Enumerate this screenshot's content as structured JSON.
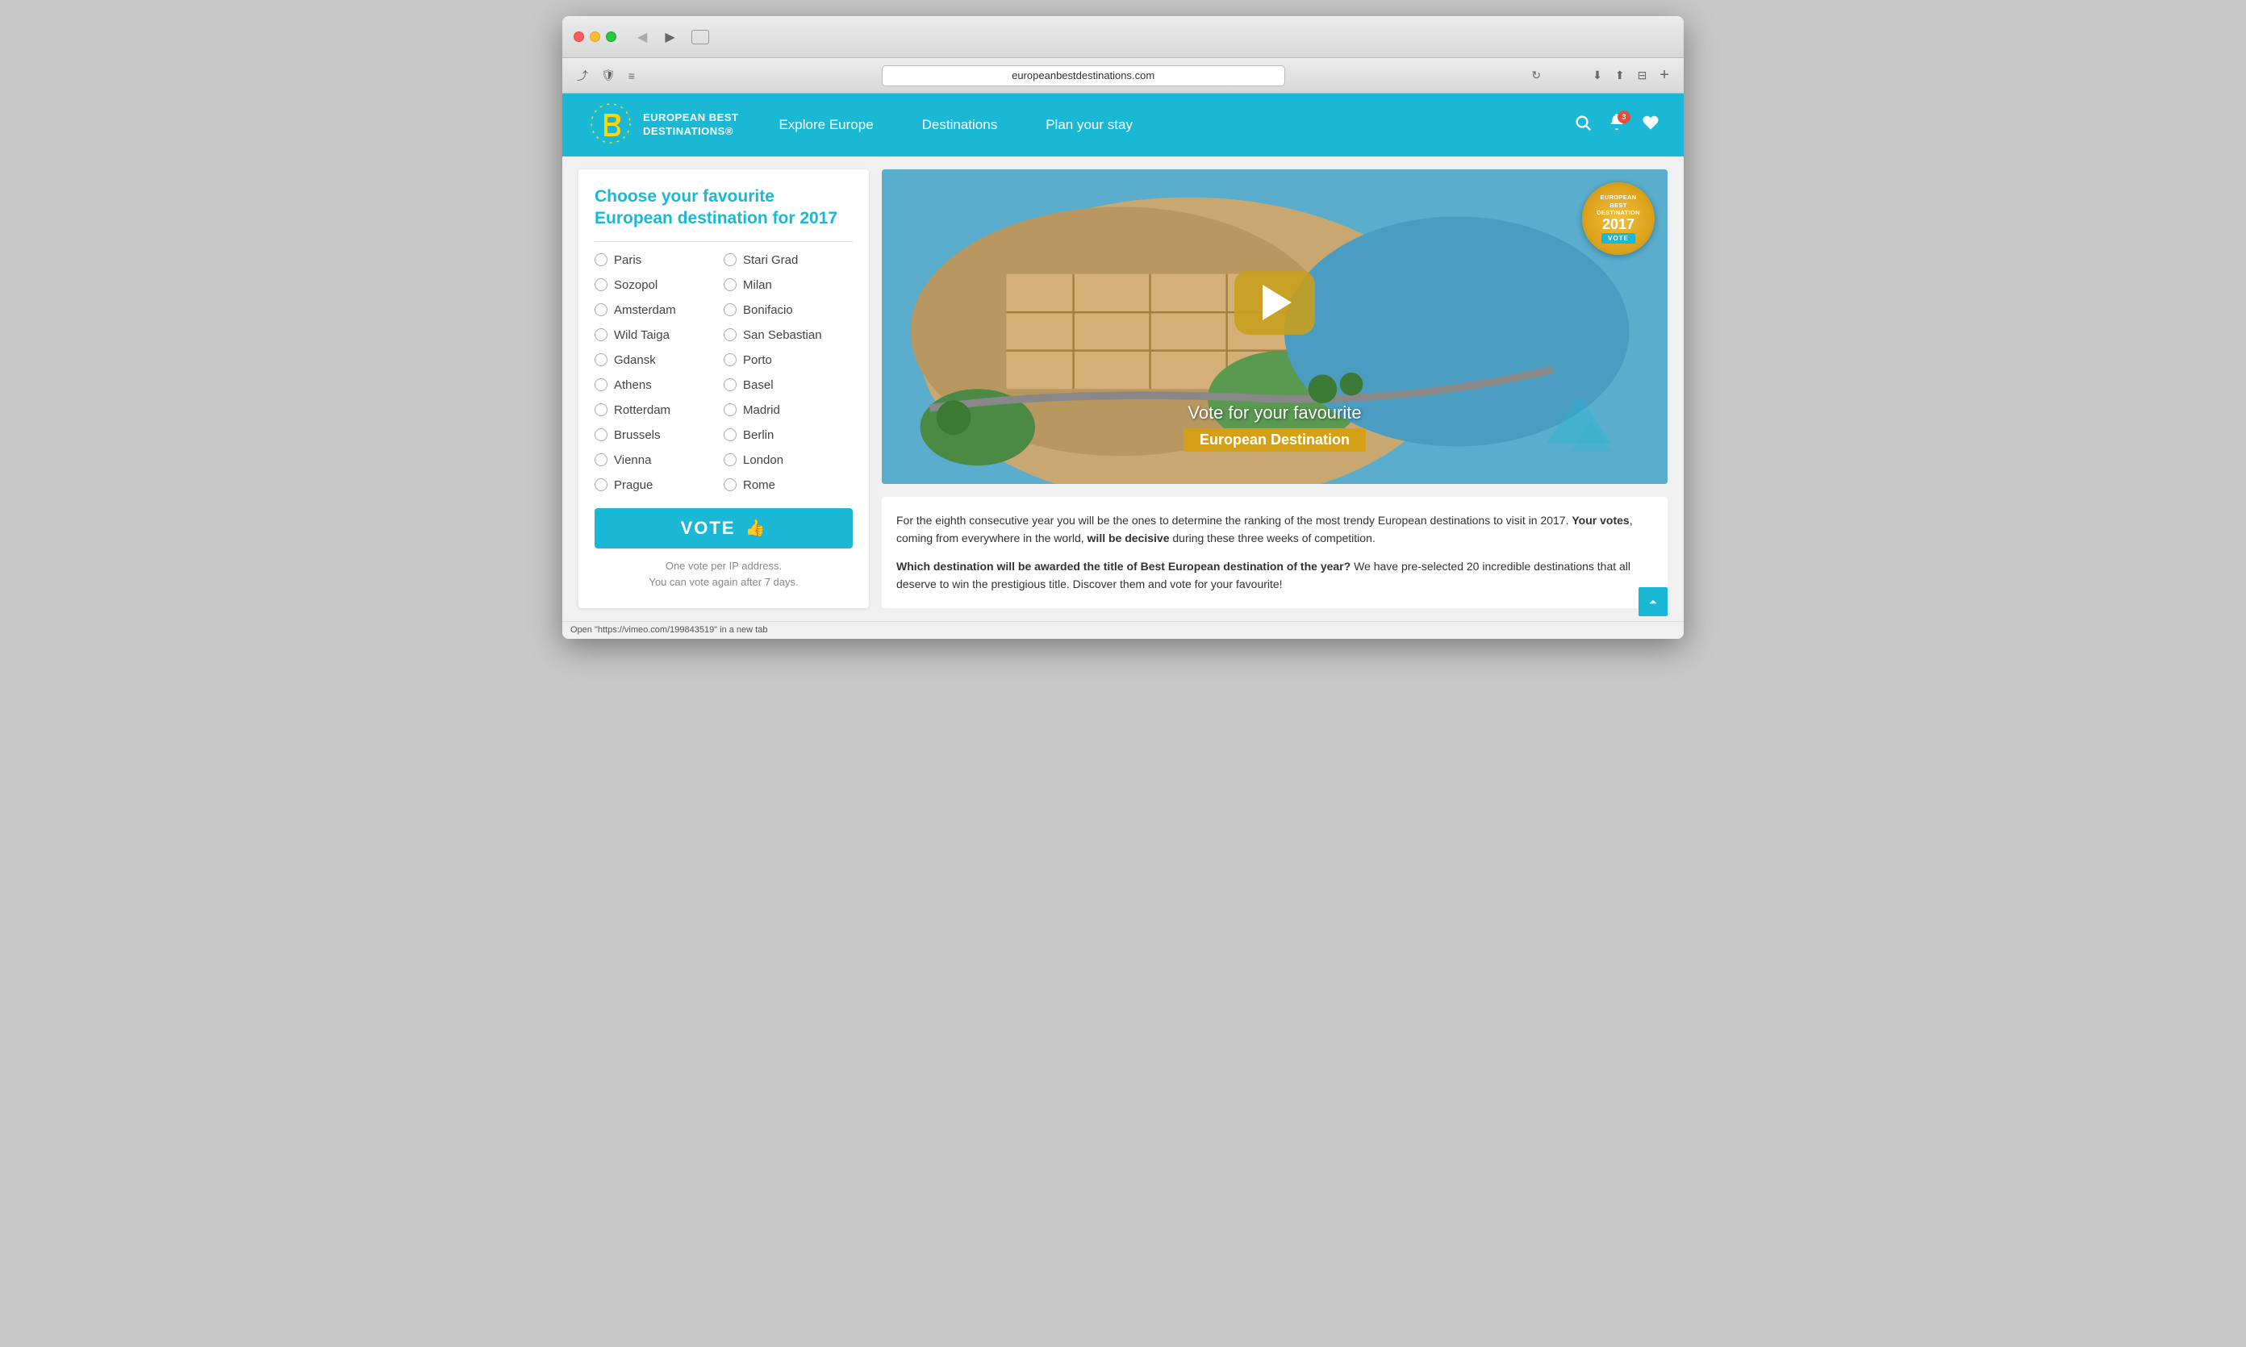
{
  "browser": {
    "url": "europeanbestdestinations.com",
    "back_btn": "‹",
    "forward_btn": "›"
  },
  "header": {
    "logo_line1": "European Best",
    "logo_line2": "Destinations®",
    "nav": {
      "items": [
        {
          "label": "Explore Europe",
          "id": "explore-europe"
        },
        {
          "label": "Destinations",
          "id": "destinations"
        },
        {
          "label": "Plan your stay",
          "id": "plan-stay"
        }
      ]
    },
    "notification_count": "3"
  },
  "vote_panel": {
    "title": "Choose your favourite European destination for 2017",
    "destinations_col1": [
      "Paris",
      "Sozopol",
      "Amsterdam",
      "Wild Taiga",
      "Gdansk",
      "Athens",
      "Rotterdam",
      "Brussels",
      "Vienna",
      "Prague"
    ],
    "destinations_col2": [
      "Stari Grad",
      "Milan",
      "Bonifacio",
      "San Sebastian",
      "Porto",
      "Basel",
      "Madrid",
      "Berlin",
      "London",
      "Rome"
    ],
    "vote_button_label": "VOTE",
    "vote_info_line1": "One vote per IP address.",
    "vote_info_line2": "You can vote again after 7 days."
  },
  "video": {
    "text_line1": "Vote for your favourite",
    "text_line2": "European Destination",
    "badge_line1": "European",
    "badge_line2": "Best",
    "badge_line3": "Destination",
    "badge_year": "2017",
    "badge_vote": "VOTE"
  },
  "description": {
    "paragraph1_start": "For the eighth consecutive year you will be the ones to determine the ranking of the most trendy European destinations to visit in 2017. ",
    "paragraph1_bold1": "Your votes",
    "paragraph1_mid": ", coming from everywhere in the world, ",
    "paragraph1_bold2": "will be decisive",
    "paragraph1_end": " during these three weeks of competition.",
    "paragraph2_start": "",
    "paragraph2_bold": "Which destination will be awarded the title of Best European destination of the year?",
    "paragraph2_end": " We have pre-selected 20 incredible destinations that all deserve to win the prestigious title. Discover them and vote for your favourite!"
  },
  "status_bar": {
    "text": "Open \"https://vimeo.com/199843519\" in a new tab"
  }
}
